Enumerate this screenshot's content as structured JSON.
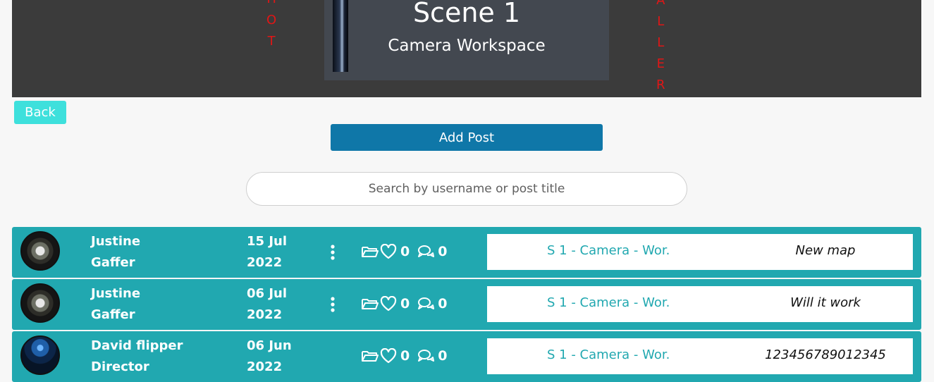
{
  "header": {
    "left_vertical": "HOT",
    "right_vertical": "ALLER",
    "scene_title": "Scene 1",
    "scene_subtitle": "Camera Workspace"
  },
  "actions": {
    "back_label": "Back",
    "add_post_label": "Add Post"
  },
  "search": {
    "placeholder": "Search by username or post title",
    "value": ""
  },
  "colors": {
    "row_bg": "#21a8b0",
    "add_button": "#0f77a8",
    "back_button": "#3ee0dc",
    "header_bg": "#3b3b3b",
    "vertical_text": "#e01616"
  },
  "posts": [
    {
      "name": "Justine",
      "role": "Gaffer",
      "date_line1": "15 Jul",
      "date_line2": "2022",
      "has_menu": true,
      "likes": "0",
      "comments": "0",
      "scene_link": "S 1 - Camera - Wor.",
      "title": "New map",
      "avatar": "dark-flower"
    },
    {
      "name": "Justine",
      "role": "Gaffer",
      "date_line1": "06 Jul",
      "date_line2": "2022",
      "has_menu": true,
      "likes": "0",
      "comments": "0",
      "scene_link": "S 1 - Camera - Wor.",
      "title": "Will it work",
      "avatar": "dark-flower"
    },
    {
      "name": "David flipper",
      "role": "Director",
      "date_line1": "06 Jun",
      "date_line2": "2022",
      "has_menu": false,
      "likes": "0",
      "comments": "0",
      "scene_link": "S 1 - Camera - Wor.",
      "title": "123456789012345",
      "avatar": "blue-light"
    }
  ]
}
